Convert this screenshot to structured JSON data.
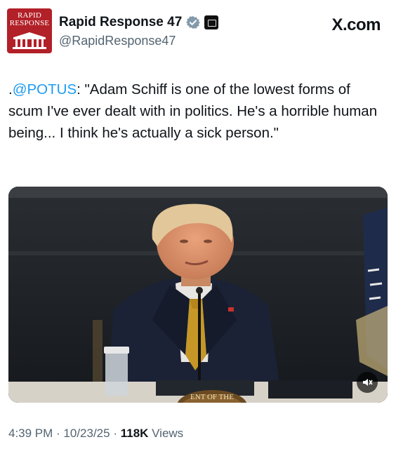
{
  "account": {
    "avatar_line1": "RAPID",
    "avatar_line2": "RESPONSE",
    "display_name": "Rapid Response 47",
    "handle": "@RapidResponse47",
    "verified_icon": "verified-badge-icon",
    "affiliate_icon": "white-house-affiliate-icon"
  },
  "brand": "X.com",
  "tweet": {
    "prefix": ".",
    "mention": "@POTUS",
    "body": ": \"Adam Schiff is one of the lowest forms of scum I've ever dealt with in politics. He's a horrible human being... I think he's actually a sick person.\""
  },
  "media": {
    "seal_text": "ENT OF THE",
    "sound_icon": "speaker-icon"
  },
  "meta": {
    "time": "4:39 PM",
    "separator": " · ",
    "date": "10/23/25",
    "views_count": "118K",
    "views_label": " Views"
  },
  "colors": {
    "link": "#1d9bf0",
    "secondary_text": "#536471",
    "avatar_red": "#b22028",
    "verified_blue": "#1d9bf0"
  }
}
